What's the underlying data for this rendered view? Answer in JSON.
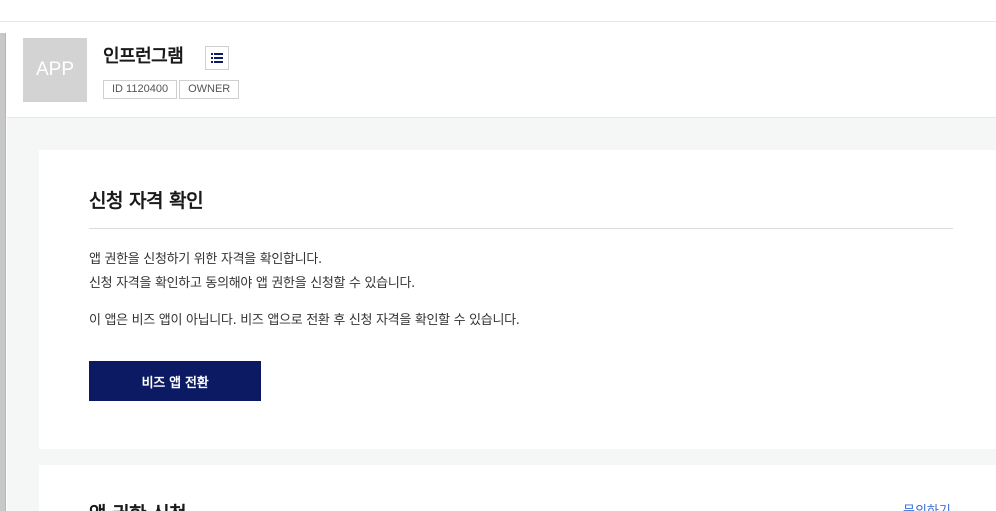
{
  "app": {
    "thumb_label": "APP",
    "name": "인프런그램",
    "tags": [
      "ID 1120400",
      "OWNER"
    ]
  },
  "eligibility": {
    "title": "신청 자격 확인",
    "desc_line1": "앱 권한을 신청하기 위한 자격을 확인합니다.",
    "desc_line2": "신청 자격을 확인하고 동의해야 앱 권한을 신청할 수 있습니다.",
    "notice": "이 앱은 비즈 앱이 아닙니다. 비즈 앱으로 전환 후 신청 자격을 확인할 수 있습니다.",
    "button_label": "비즈 앱 전환"
  },
  "permission": {
    "title": "앱 권한 신청",
    "inquiry_link": "문의하기"
  },
  "colors": {
    "primary_button": "#0b1a63",
    "link": "#3b6fd6",
    "page_background": "#f5f6f6"
  },
  "icons": {
    "menu_button": "list-icon"
  }
}
